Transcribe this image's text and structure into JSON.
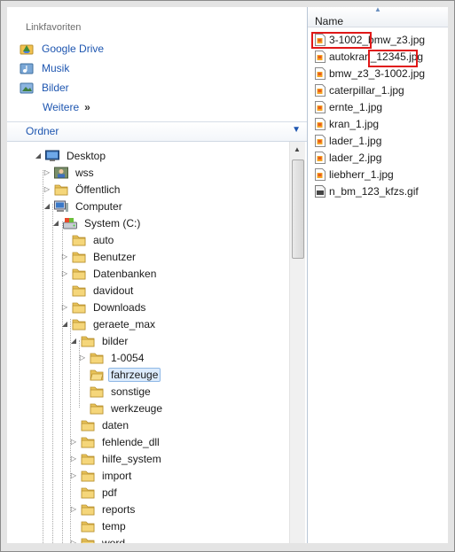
{
  "favorites": {
    "header": "Linkfavoriten",
    "items": [
      "Google Drive",
      "Musik",
      "Bilder"
    ],
    "more_label": "Weitere",
    "more_chevron": "»"
  },
  "folders_panel": {
    "label": "Ordner",
    "toggle": "▼"
  },
  "tree": [
    {
      "label": "Desktop",
      "level": 0,
      "arrow": "expanded",
      "icon": "desktop-icon"
    },
    {
      "label": "wss",
      "level": 1,
      "arrow": "collapsed",
      "icon": "user-folder-icon"
    },
    {
      "label": "Öffentlich",
      "level": 1,
      "arrow": "collapsed",
      "icon": "folder-icon"
    },
    {
      "label": "Computer",
      "level": 1,
      "arrow": "expanded",
      "icon": "computer-icon"
    },
    {
      "label": "System (C:)",
      "level": 2,
      "arrow": "expanded",
      "icon": "drive-icon"
    },
    {
      "label": "auto",
      "level": 3,
      "arrow": "none",
      "icon": "folder-icon"
    },
    {
      "label": "Benutzer",
      "level": 3,
      "arrow": "collapsed",
      "icon": "folder-icon"
    },
    {
      "label": "Datenbanken",
      "level": 3,
      "arrow": "collapsed",
      "icon": "folder-icon"
    },
    {
      "label": "davidout",
      "level": 3,
      "arrow": "none",
      "icon": "folder-icon"
    },
    {
      "label": "Downloads",
      "level": 3,
      "arrow": "collapsed",
      "icon": "folder-icon"
    },
    {
      "label": "geraete_max",
      "level": 3,
      "arrow": "expanded",
      "icon": "folder-icon"
    },
    {
      "label": "bilder",
      "level": 4,
      "arrow": "expanded",
      "icon": "folder-icon"
    },
    {
      "label": "1-0054",
      "level": 5,
      "arrow": "collapsed",
      "icon": "folder-icon"
    },
    {
      "label": "fahrzeuge",
      "level": 5,
      "arrow": "none",
      "icon": "folder-open-icon",
      "selected": true
    },
    {
      "label": "sonstige",
      "level": 5,
      "arrow": "none",
      "icon": "folder-icon"
    },
    {
      "label": "werkzeuge",
      "level": 5,
      "arrow": "none",
      "icon": "folder-icon"
    },
    {
      "label": "daten",
      "level": 4,
      "arrow": "none",
      "icon": "folder-icon"
    },
    {
      "label": "fehlende_dll",
      "level": 4,
      "arrow": "collapsed",
      "icon": "folder-icon"
    },
    {
      "label": "hilfe_system",
      "level": 4,
      "arrow": "collapsed",
      "icon": "folder-icon"
    },
    {
      "label": "import",
      "level": 4,
      "arrow": "collapsed",
      "icon": "folder-icon"
    },
    {
      "label": "pdf",
      "level": 4,
      "arrow": "none",
      "icon": "folder-icon"
    },
    {
      "label": "reports",
      "level": 4,
      "arrow": "collapsed",
      "icon": "folder-icon"
    },
    {
      "label": "temp",
      "level": 4,
      "arrow": "none",
      "icon": "folder-icon"
    },
    {
      "label": "word",
      "level": 4,
      "arrow": "collapsed",
      "icon": "folder-icon"
    }
  ],
  "file_list": {
    "column_header": "Name",
    "files": [
      {
        "name": "3-1002_bmw_z3.jpg",
        "type": "jpg"
      },
      {
        "name": "autokran_12345.jpg",
        "type": "jpg"
      },
      {
        "name": "bmw_z3_3-1002.jpg",
        "type": "jpg"
      },
      {
        "name": "caterpillar_1.jpg",
        "type": "jpg"
      },
      {
        "name": "ernte_1.jpg",
        "type": "jpg"
      },
      {
        "name": "kran_1.jpg",
        "type": "jpg"
      },
      {
        "name": "lader_1.jpg",
        "type": "jpg"
      },
      {
        "name": "lader_2.jpg",
        "type": "jpg"
      },
      {
        "name": "liebherr_1.jpg",
        "type": "jpg"
      },
      {
        "name": "n_bm_123_kfzs.gif",
        "type": "gif"
      }
    ]
  },
  "colors": {
    "link": "#1e56b0",
    "highlight_box": "#e01818",
    "selection": "#dcebfc"
  }
}
